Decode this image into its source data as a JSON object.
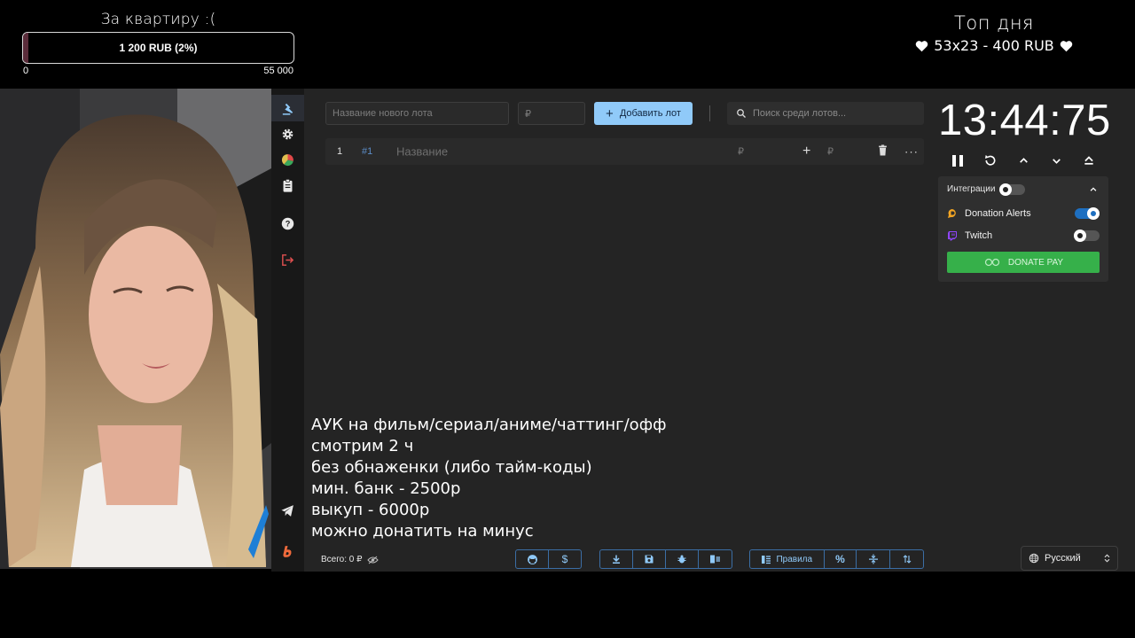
{
  "overlay": {
    "goal": {
      "title": "За квартиру :(",
      "amount_label": "1 200 RUB (2%)",
      "progress_percent": 2,
      "scale_min": "0",
      "scale_max": "55 000"
    },
    "top_day": {
      "title": "Топ дня",
      "entry": "53x23 - 400 RUB"
    },
    "stream_text": [
      "АУК на фильм/сериал/аниме/чаттинг/офф",
      "смотрим 2 ч",
      "без обнаженки (либо тайм-коды)",
      "мин. банк - 2500р",
      "выкуп - 6000р",
      "можно донатить на минус"
    ]
  },
  "sidebar": {
    "items": [
      {
        "name": "auction-icon",
        "active": true
      },
      {
        "name": "settings-icon"
      },
      {
        "name": "stats-icon"
      },
      {
        "name": "history-icon"
      },
      {
        "name": "help-icon"
      },
      {
        "name": "logout-icon"
      },
      {
        "name": "telegram-icon"
      },
      {
        "name": "boosty-icon"
      }
    ]
  },
  "toolbar": {
    "lot_name_placeholder": "Название нового лота",
    "amount_placeholder": "₽",
    "add_lot_label": "Добавить лот",
    "search_placeholder": "Поиск среди лотов..."
  },
  "lots": [
    {
      "position": "1",
      "id": "#1",
      "name": "Название",
      "currency": "₽",
      "add": "+",
      "currency2": "₽",
      "more": "···"
    }
  ],
  "timer": {
    "display": "13:44:75"
  },
  "integrations": {
    "title": "Интеграции",
    "items": [
      {
        "label": "Donation Alerts",
        "enabled": true
      },
      {
        "label": "Twitch",
        "enabled": false
      }
    ],
    "donate_pay_label": "DONATE PAY"
  },
  "footer": {
    "total_label": "Всего: 0 ₽",
    "rules_label": "Правила",
    "language": "Русский"
  },
  "colors": {
    "accent": "#90caf9",
    "app_bg": "#242424",
    "rail_bg": "#181818",
    "donate_pay": "#36b04a",
    "logout": "#e05050",
    "toggle_on": "#1e6fc0"
  }
}
